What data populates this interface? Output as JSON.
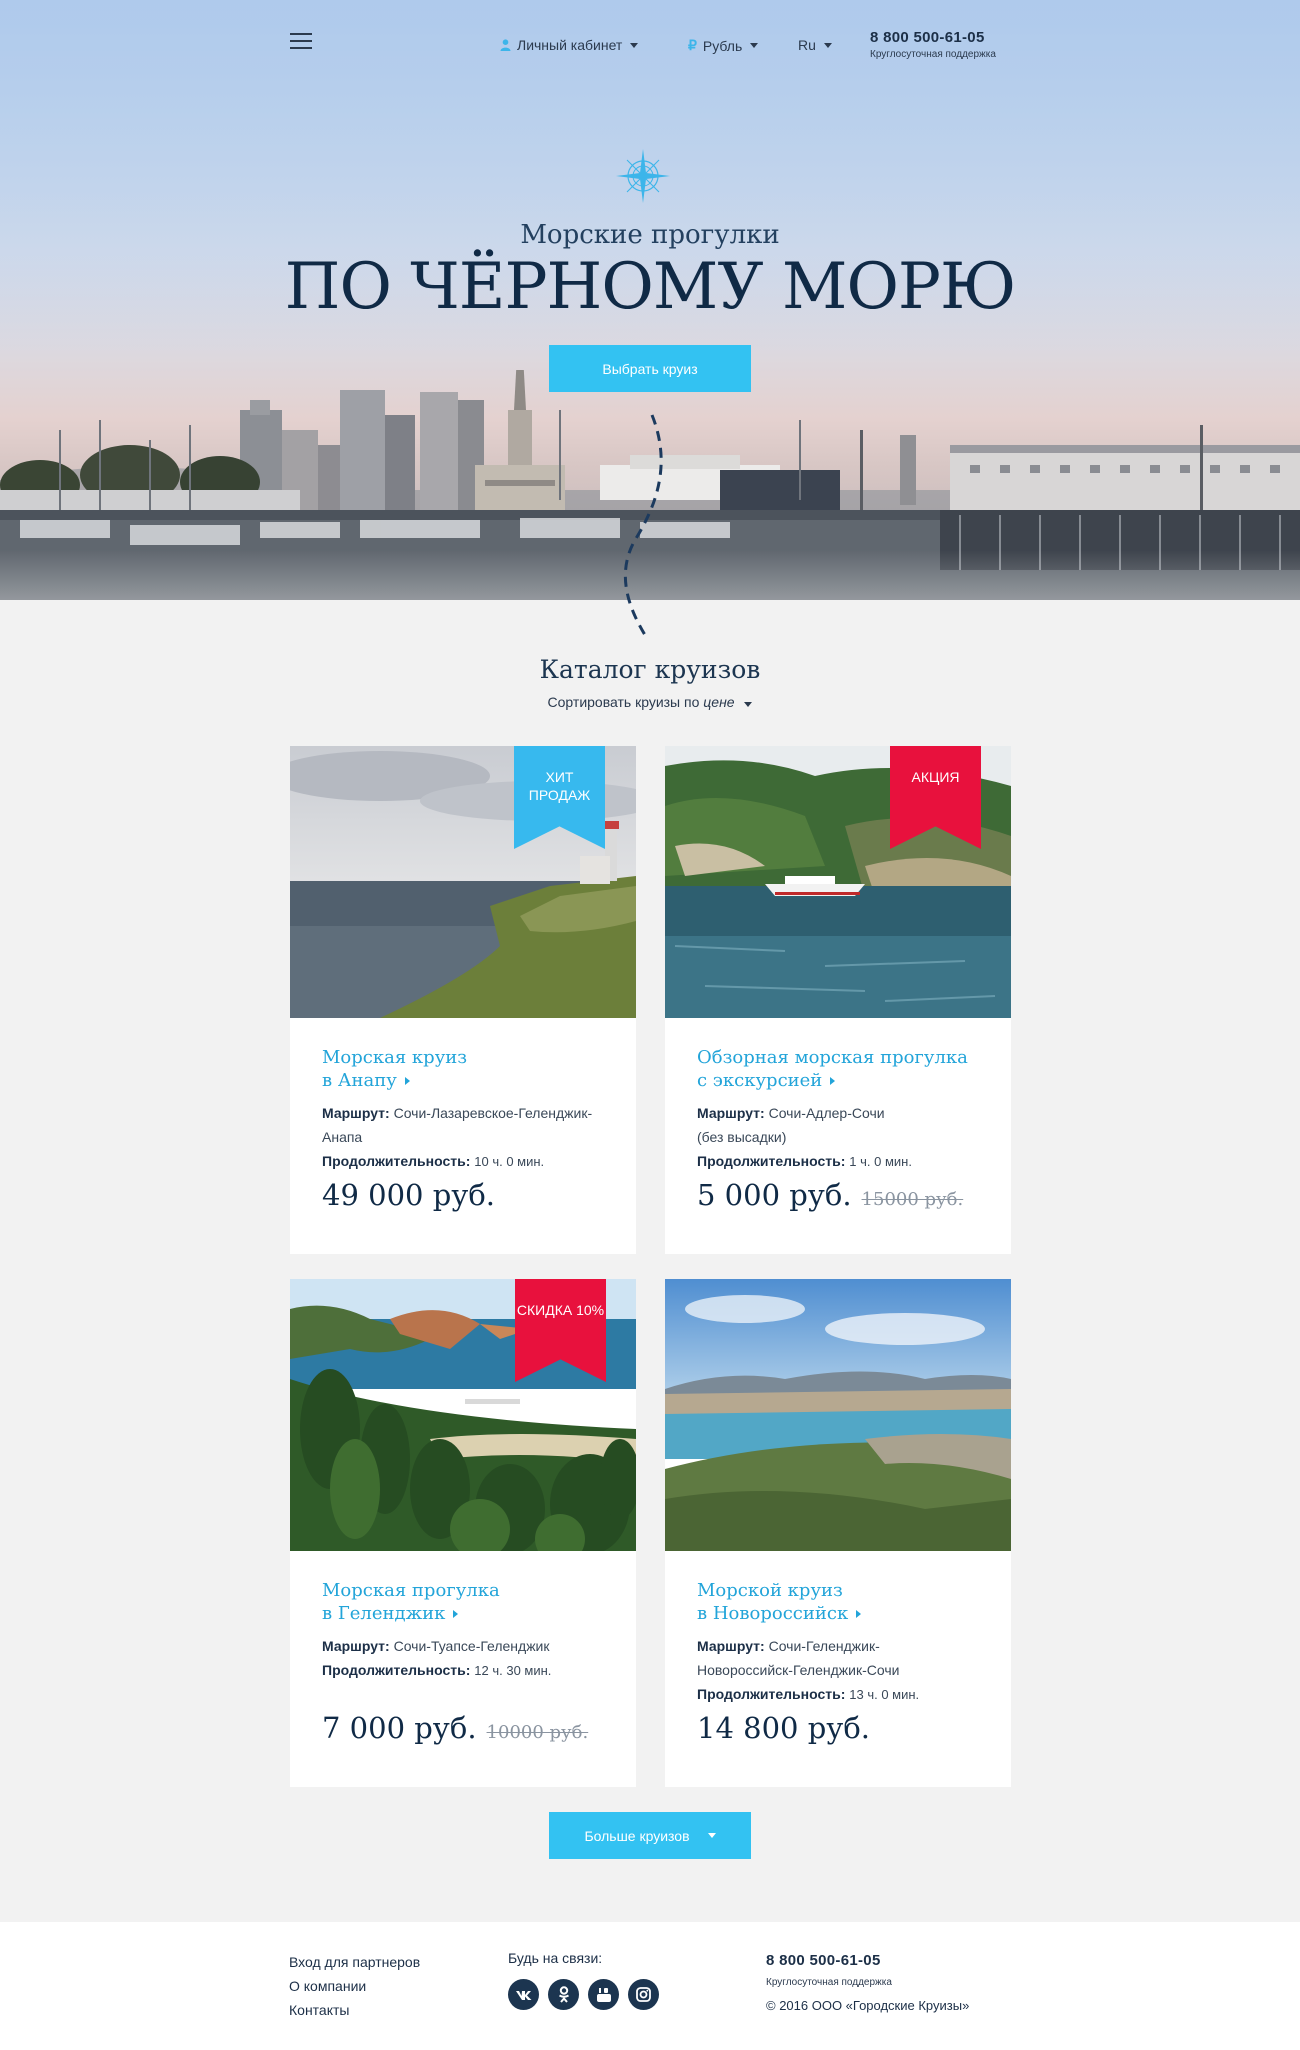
{
  "header": {
    "account_label": "Личный кабинет",
    "currency_label": "Рубль",
    "currency_symbol": "₽",
    "language_label": "Ru",
    "phone": "8 800 500-61-05",
    "phone_note": "Круглосуточная поддержка"
  },
  "hero": {
    "subtitle": "Морские прогулки",
    "title": "ПО ЧЁРНОМУ МОРЮ",
    "cta_label": "Выбрать круиз"
  },
  "catalog": {
    "title": "Каталог круизов",
    "sort_prefix": "Сортировать круизы по",
    "sort_value": "цене",
    "more_label": "Больше круизов",
    "cards": [
      {
        "ribbon": "ХИТ ПРОДАЖ",
        "ribbon_color": "#37b9ee",
        "name_line1": "Морская круиз",
        "name_line2": "в Анапу",
        "route_label": "Маршрут:",
        "route_value": "Сочи-Лазаревское-Геленджик-Анапа",
        "duration_label": "Продолжительность:",
        "duration_value": "10 ч. 0 мин.",
        "price": "49 000 руб.",
        "old_price": ""
      },
      {
        "ribbon": "АКЦИЯ",
        "ribbon_color": "#e8113d",
        "name_line1": "Обзорная морская прогулка",
        "name_line2": "с экскурсией",
        "route_label": "Маршрут:",
        "route_value": "Сочи-Адлер-Сочи (без высадки)",
        "duration_label": "Продолжительность:",
        "duration_value": "1 ч. 0 мин.",
        "price": "5 000 руб.",
        "old_price": "15000 руб."
      },
      {
        "ribbon": "СКИДКА 10%",
        "ribbon_color": "#e8113d",
        "name_line1": "Морская прогулка",
        "name_line2": "в Геленджик",
        "route_label": "Маршрут:",
        "route_value": "Сочи-Туапсе-Геленджик",
        "duration_label": "Продолжительность:",
        "duration_value": "12 ч. 30 мин.",
        "price": "7 000 руб.",
        "old_price": "10000 руб."
      },
      {
        "ribbon": "",
        "name_line1": "Морской круиз",
        "name_line2": "в Новороссийск",
        "route_label": "Маршрут:",
        "route_value": "Сочи-Геленджик-Новороссийск-Геленджик-Сочи",
        "duration_label": "Продолжительность:",
        "duration_value": "13 ч. 0 мин.",
        "price": "14 800 руб.",
        "old_price": ""
      }
    ]
  },
  "footer": {
    "links": [
      "Вход для партнеров",
      "О компании",
      "Контакты"
    ],
    "social_title": "Будь на связи:",
    "social_icons": [
      "vk-icon",
      "odnoklassniki-icon",
      "youtube-icon",
      "instagram-icon"
    ],
    "phone": "8 800 500-61-05",
    "phone_note": "Круглосуточная поддержка",
    "copyright": "© 2016 ООО «Городские Круизы»"
  },
  "colors": {
    "accent": "#33c2f2",
    "title_navy": "#102a46",
    "link_blue": "#22a4d9",
    "ribbon_red": "#e8113d"
  }
}
